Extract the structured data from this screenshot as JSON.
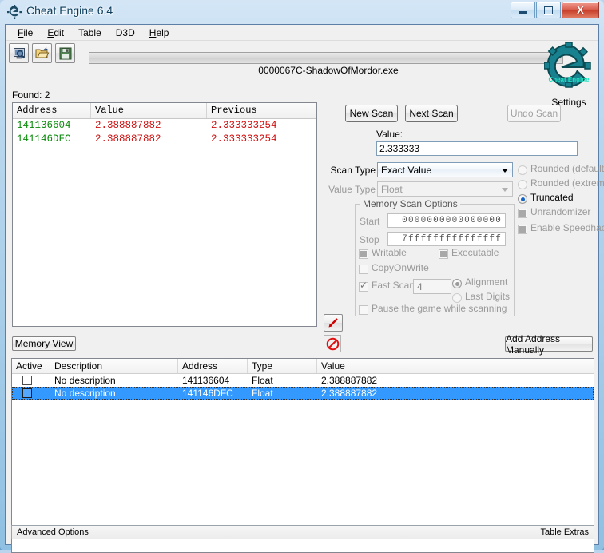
{
  "window": {
    "title": "Cheat Engine 6.4",
    "icon": "cheat-engine-logo-icon",
    "buttons": {
      "minimize": "–",
      "maximize": "❑",
      "close": "X"
    }
  },
  "menubar": {
    "items": [
      {
        "label": "File",
        "accel": "F"
      },
      {
        "label": "Edit",
        "accel": "E"
      },
      {
        "label": "Table",
        "accel": "T"
      },
      {
        "label": "D3D",
        "accel": ""
      },
      {
        "label": "Help",
        "accel": "H"
      }
    ]
  },
  "toolbar": {
    "buttons": [
      {
        "name": "open-process-button",
        "icon": "computer-magnifier-icon"
      },
      {
        "name": "open-file-button",
        "icon": "folder-open-icon"
      },
      {
        "name": "save-file-button",
        "icon": "floppy-disk-icon"
      }
    ]
  },
  "process": {
    "title": "0000067C-ShadowOfMordor.exe",
    "progress_percent": 0
  },
  "settings": {
    "label": "Settings",
    "logo_text": "Cheat Engine",
    "logo_color": "#19818f"
  },
  "scan_results": {
    "found_label": "Found: 2",
    "columns": [
      "Address",
      "Value",
      "Previous"
    ],
    "rows": [
      {
        "address": "141136604",
        "value": "2.388887882",
        "previous": "2.333333254"
      },
      {
        "address": "141146DFC",
        "value": "2.388887882",
        "previous": "2.333333254"
      }
    ],
    "address_color": "#0a8a0a",
    "value_color": "#d01010"
  },
  "scan_panel": {
    "new_scan_label": "New Scan",
    "next_scan_label": "Next Scan",
    "undo_scan_label": "Undo Scan",
    "undo_scan_enabled": false,
    "value_label": "Value:",
    "value_input": "2.333333",
    "scan_type_label": "Scan Type",
    "scan_type_value": "Exact Value",
    "value_type_label": "Value Type",
    "value_type_value": "Float",
    "value_type_enabled": false
  },
  "rounding_options": {
    "items": [
      {
        "label": "Rounded (default)",
        "selected": false,
        "enabled": false
      },
      {
        "label": "Rounded (extreme)",
        "selected": false,
        "enabled": false
      },
      {
        "label": "Truncated",
        "selected": true,
        "enabled": true
      }
    ]
  },
  "extra_options": {
    "items": [
      {
        "label": "Unrandomizer",
        "checked": false,
        "enabled": false
      },
      {
        "label": "Enable Speedhack",
        "checked": false,
        "enabled": false
      }
    ]
  },
  "memory_scan_options": {
    "title": "Memory Scan Options",
    "start_label": "Start",
    "start_value": "0000000000000000",
    "stop_label": "Stop",
    "stop_value": "7fffffffffffffff",
    "writable_label": "Writable",
    "writable_checked": true,
    "executable_label": "Executable",
    "executable_checked": true,
    "copyonwrite_label": "CopyOnWrite",
    "copyonwrite_checked": false,
    "fast_scan_label": "Fast Scan",
    "fast_scan_checked": true,
    "fast_scan_value": "4",
    "alignment_label": "Alignment",
    "alignment_selected": true,
    "last_digits_label": "Last Digits",
    "last_digits_selected": false,
    "pause_game_label": "Pause the game while scanning",
    "pause_game_checked": false
  },
  "actions": {
    "memory_view_label": "Memory View",
    "add_address_label": "Add Address Manually",
    "add_to_table_icon": "red-arrow-down-left-icon",
    "no_entry_icon": "red-no-entry-icon"
  },
  "cheat_table": {
    "columns": [
      "Active",
      "Description",
      "Address",
      "Type",
      "Value"
    ],
    "rows": [
      {
        "active": false,
        "description": "No description",
        "address": "141136604",
        "type": "Float",
        "value": "2.388887882",
        "selected": false
      },
      {
        "active": false,
        "description": "No description",
        "address": "141146DFC",
        "type": "Float",
        "value": "2.388887882",
        "selected": true
      }
    ],
    "selection_color": "#3399ff"
  },
  "statusbar": {
    "left_label": "Advanced Options",
    "right_label": "Table Extras"
  }
}
